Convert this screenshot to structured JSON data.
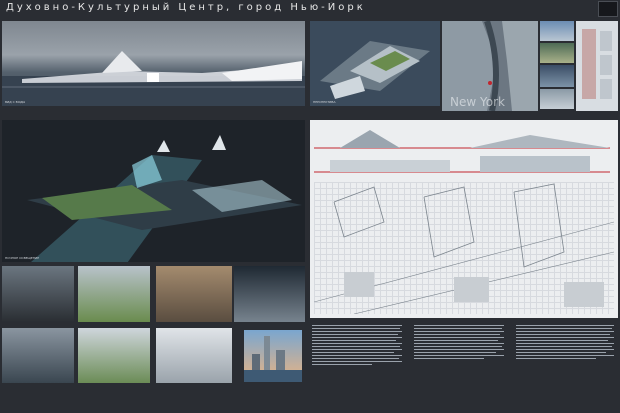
{
  "title": "Духовно-Культурный Центр, город Нью-Йорк",
  "map_overlay": "New York",
  "captions": {
    "main_view": "ВИД С ВОДЫ",
    "perspective": "ПЕРСПЕКТИВА",
    "night_view": "НОЧНОЕ ОСВЕЩЕНИЕ"
  },
  "colors": {
    "background": "#2a2d33",
    "water": "#3c4a5a",
    "sheet": "#eceef0",
    "accent": "#c2262e"
  }
}
